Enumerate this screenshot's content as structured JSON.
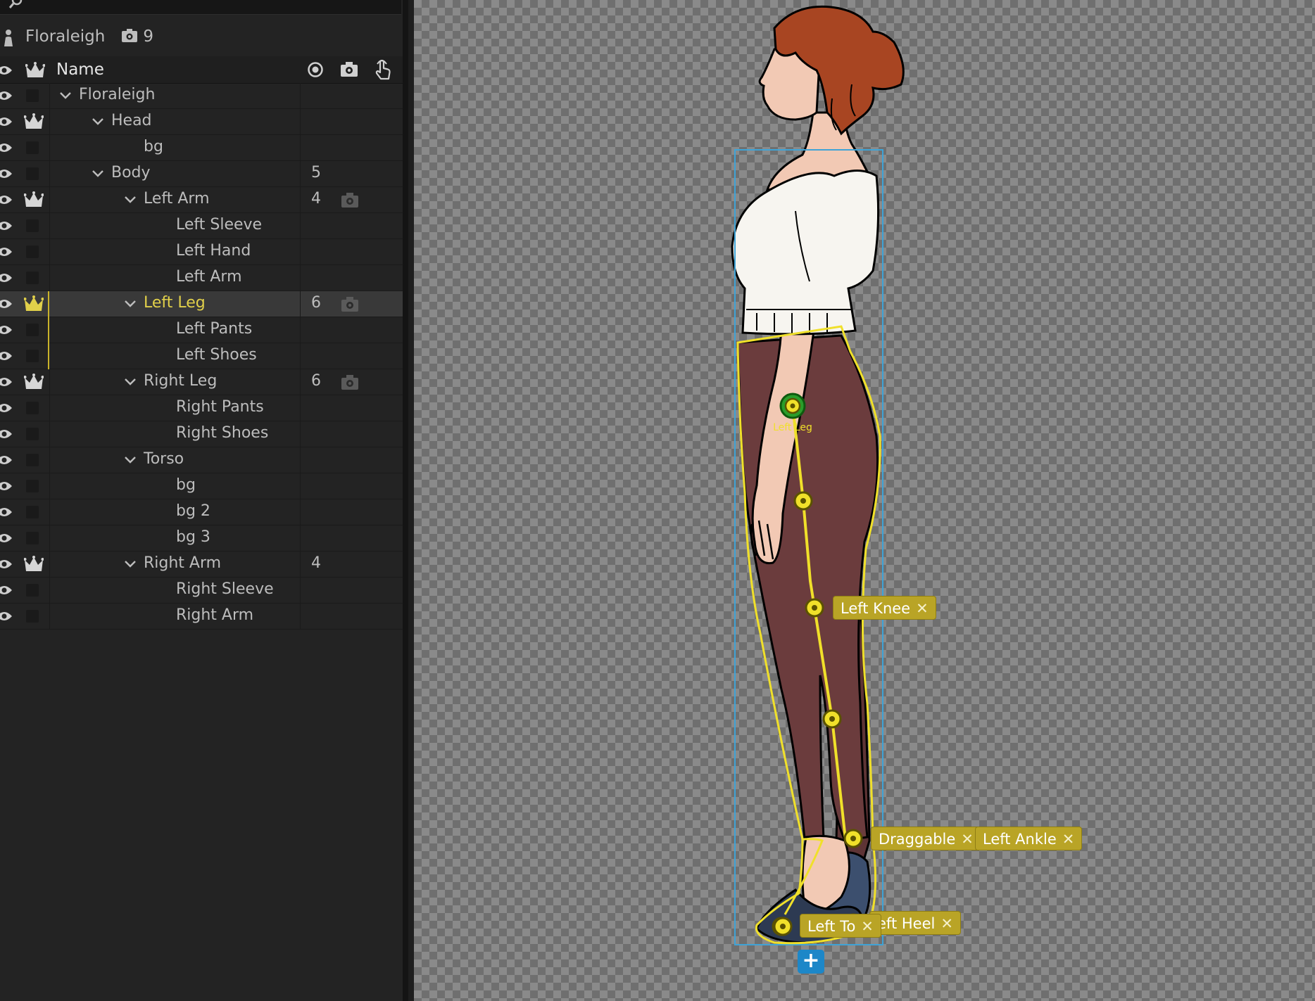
{
  "puppet": {
    "name": "Floraleigh",
    "cam_count": "9"
  },
  "columns": {
    "name": "Name"
  },
  "rows": [
    {
      "label": "Floraleigh",
      "indent": 0,
      "expandable": true,
      "crown": false,
      "count": "",
      "cam": false,
      "selected": false,
      "gold": false
    },
    {
      "label": "Head",
      "indent": 1,
      "expandable": true,
      "crown": true,
      "count": "",
      "cam": false,
      "selected": false,
      "gold": false
    },
    {
      "label": "bg",
      "indent": 2,
      "expandable": false,
      "crown": false,
      "count": "",
      "cam": false,
      "selected": false,
      "gold": false
    },
    {
      "label": "Body",
      "indent": 1,
      "expandable": true,
      "crown": false,
      "count": "5",
      "cam": false,
      "selected": false,
      "gold": false
    },
    {
      "label": "Left Arm",
      "indent": 2,
      "expandable": true,
      "crown": true,
      "count": "4",
      "cam": true,
      "selected": false,
      "gold": false
    },
    {
      "label": "Left Sleeve",
      "indent": 3,
      "expandable": false,
      "crown": false,
      "count": "",
      "cam": false,
      "selected": false,
      "gold": false
    },
    {
      "label": "Left Hand",
      "indent": 3,
      "expandable": false,
      "crown": false,
      "count": "",
      "cam": false,
      "selected": false,
      "gold": false
    },
    {
      "label": "Left Arm",
      "indent": 3,
      "expandable": false,
      "crown": false,
      "count": "",
      "cam": false,
      "selected": false,
      "gold": false
    },
    {
      "label": "Left Leg",
      "indent": 2,
      "expandable": true,
      "crown": true,
      "count": "6",
      "cam": true,
      "selected": true,
      "gold": true
    },
    {
      "label": "Left Pants",
      "indent": 3,
      "expandable": false,
      "crown": false,
      "count": "",
      "cam": false,
      "selected": false,
      "gold": true
    },
    {
      "label": "Left Shoes",
      "indent": 3,
      "expandable": false,
      "crown": false,
      "count": "",
      "cam": false,
      "selected": false,
      "gold": true
    },
    {
      "label": "Right Leg",
      "indent": 2,
      "expandable": true,
      "crown": true,
      "count": "6",
      "cam": true,
      "selected": false,
      "gold": false
    },
    {
      "label": "Right Pants",
      "indent": 3,
      "expandable": false,
      "crown": false,
      "count": "",
      "cam": false,
      "selected": false,
      "gold": false
    },
    {
      "label": "Right Shoes",
      "indent": 3,
      "expandable": false,
      "crown": false,
      "count": "",
      "cam": false,
      "selected": false,
      "gold": false
    },
    {
      "label": "Torso",
      "indent": 2,
      "expandable": true,
      "crown": false,
      "count": "",
      "cam": false,
      "selected": false,
      "gold": false
    },
    {
      "label": "bg",
      "indent": 3,
      "expandable": false,
      "crown": false,
      "count": "",
      "cam": false,
      "selected": false,
      "gold": false
    },
    {
      "label": "bg 2",
      "indent": 3,
      "expandable": false,
      "crown": false,
      "count": "",
      "cam": false,
      "selected": false,
      "gold": false
    },
    {
      "label": "bg 3",
      "indent": 3,
      "expandable": false,
      "crown": false,
      "count": "",
      "cam": false,
      "selected": false,
      "gold": false
    },
    {
      "label": "Right Arm",
      "indent": 2,
      "expandable": true,
      "crown": true,
      "count": "4",
      "cam": false,
      "selected": false,
      "gold": false
    },
    {
      "label": "Right Sleeve",
      "indent": 3,
      "expandable": false,
      "crown": false,
      "count": "",
      "cam": false,
      "selected": false,
      "gold": false
    },
    {
      "label": "Right Arm",
      "indent": 3,
      "expandable": false,
      "crown": false,
      "count": "",
      "cam": false,
      "selected": false,
      "gold": false
    }
  ],
  "canvas": {
    "handle_label": "Left Leg",
    "tags": {
      "knee": "Left Knee",
      "draggable": "Draggable",
      "ankle": "Left Ankle",
      "toe": "Left To",
      "heel": "eft Heel"
    },
    "close_glyph": "✕",
    "add_glyph": "+"
  },
  "colors": {
    "accent_gold": "#b9a426",
    "selection_gold": "#e1d04a",
    "bounds_blue": "#3fa3d6",
    "add_button": "#1d87c8",
    "hair": "#a84522",
    "pants": "#6b3c3d",
    "blouse": "#f7f5f0",
    "skin": "#f2c9b4"
  }
}
